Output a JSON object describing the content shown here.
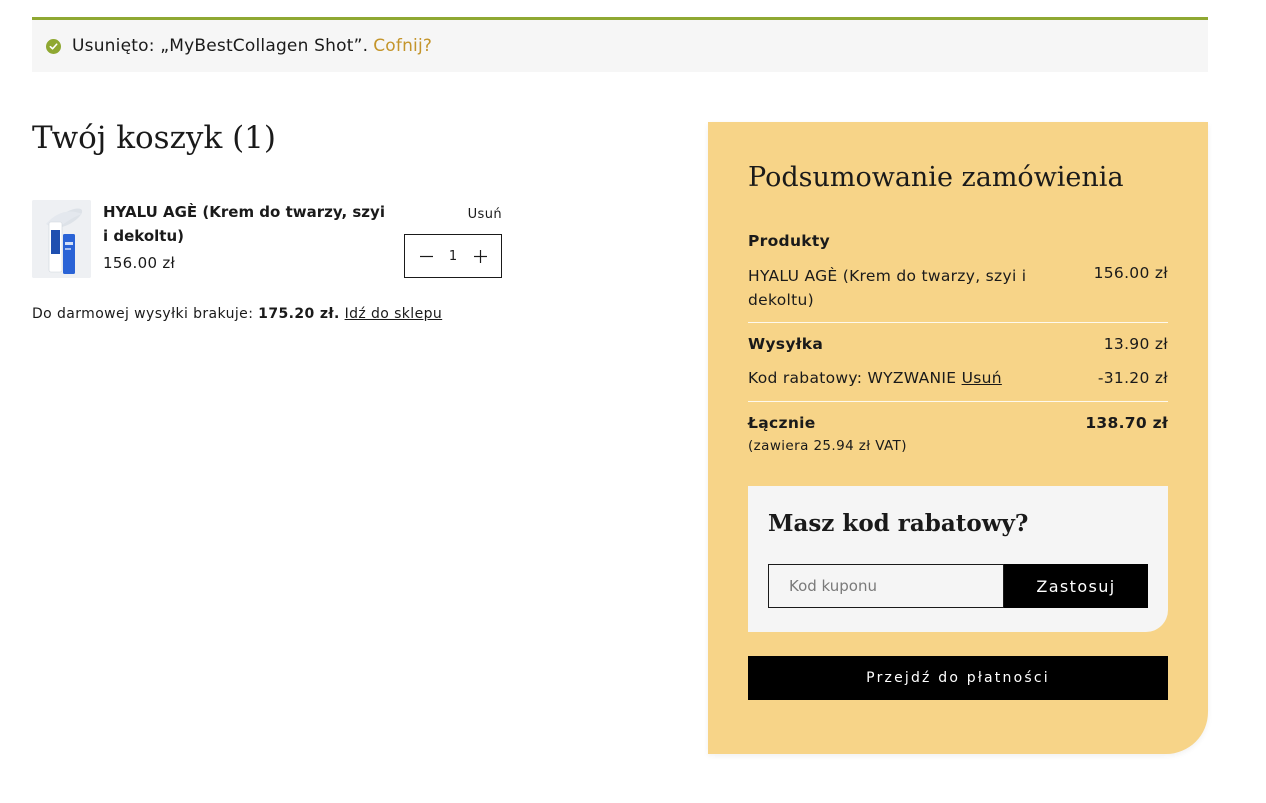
{
  "notice": {
    "message": "Usunięto: „MyBestCollagen Shot”.",
    "undo_label": "Cofnij?",
    "icon": "check-circle-icon",
    "accent_color": "#8fa832"
  },
  "cart": {
    "title": "Twój koszyk (1)",
    "items": [
      {
        "name": "HYALU AGÈ (Krem do twarzy, szyi i dekoltu)",
        "price": "156.00 zł",
        "remove_label": "Usuń",
        "quantity": "1"
      }
    ],
    "shipping_note": {
      "prefix": "Do darmowej wysyłki brakuje:",
      "amount": "175.20 zł.",
      "link_label": "Idź do sklepu"
    }
  },
  "summary": {
    "title": "Podsumowanie zamówienia",
    "products_label": "Produkty",
    "product_line": {
      "name": "HYALU AGÈ (Krem do twarzy, szyi i dekoltu)",
      "price": "156.00 zł"
    },
    "shipping_label": "Wysyłka",
    "shipping_value": "13.90 zł",
    "discount_label": "Kod rabatowy: WYZWANIE",
    "discount_remove_label": "Usuń",
    "discount_value": "-31.20 zł",
    "total_label": "Łącznie",
    "total_value": "138.70 zł",
    "vat_note": "(zawiera 25.94 zł VAT)",
    "background_color": "#f7d488"
  },
  "coupon": {
    "title": "Masz kod rabatowy?",
    "placeholder": "Kod kuponu",
    "value": "",
    "apply_label": "Zastosuj"
  },
  "checkout": {
    "label": "Przejdź do płatności"
  }
}
